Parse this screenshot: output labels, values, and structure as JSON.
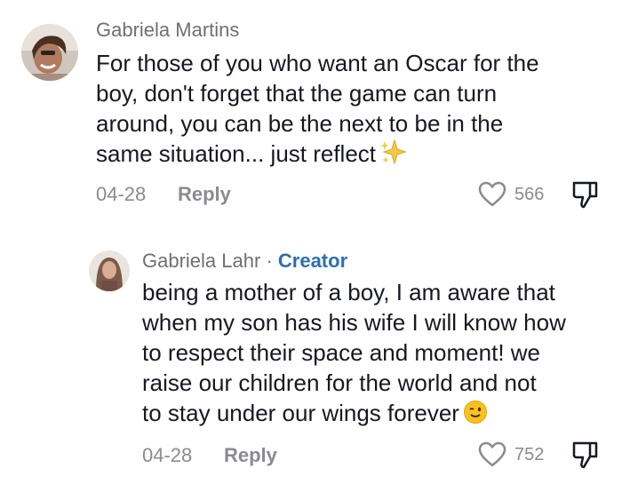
{
  "comment": {
    "author": "Gabriela Martins",
    "text_lines": [
      "For those of you who want an Oscar for the",
      "boy, don't forget that the game can turn",
      "around, you can be the next to be in the",
      "same situation... just reflect"
    ],
    "date": "04-28",
    "reply_label": "Reply",
    "likes": "566"
  },
  "reply": {
    "author": "Gabriela Lahr",
    "separator": "·",
    "badge": "Creator",
    "text_lines": [
      "being a mother of a boy, I am aware that",
      "when my son has his wife I will know how",
      "to respect their space and moment! we",
      "raise our children for the world and not",
      "to stay under our wings forever"
    ],
    "date": "04-28",
    "reply_label": "Reply",
    "likes": "752"
  },
  "icons": {
    "sparkles": "sparkles-emoji",
    "wink": "winking-face-emoji",
    "like": "heart-outline-icon",
    "dislike": "thumbs-down-icon"
  },
  "colors": {
    "text": "#161823",
    "muted": "#8a8b91",
    "creator_badge": "#2b6fb2"
  }
}
